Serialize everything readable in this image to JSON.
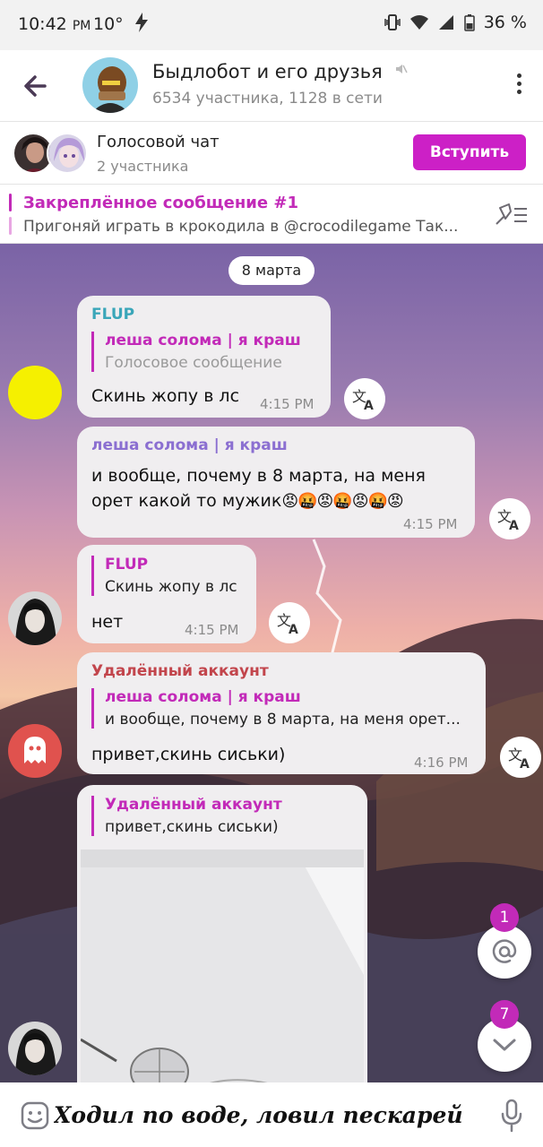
{
  "status_bar": {
    "time": "10:42",
    "ampm": "PM",
    "temp": "10°",
    "battery": "36 %"
  },
  "header": {
    "title": "Быдлобот и его друзья",
    "subtitle": "6534 участника, 1128 в сети"
  },
  "voice_chat": {
    "title": "Голосовой чат",
    "subtitle": "2 участника",
    "join_label": "Вступить"
  },
  "pinned": {
    "title": "Закреплённое сообщение #1",
    "text": "Пригоняй играть в крокодила в @crocodilegame Так..."
  },
  "chat": {
    "date": "8 марта",
    "messages": [
      {
        "sender": "FLUP",
        "reply_name": "леша солома | я краш",
        "reply_text": "Голосовое сообщение",
        "text": "Скинь жопу в лс",
        "time": "4:15 PM"
      },
      {
        "sender": "леша солома | я краш",
        "text_line1": "и вообще, почему в 8 марта, на меня",
        "text_line2": "орет какой то мужик",
        "emoji": "😡🤬😡🤬😡🤬😡",
        "time": "4:15 PM"
      },
      {
        "reply_name": "FLUP",
        "reply_text": "Скинь жопу в лс",
        "text": "нет",
        "time": "4:15 PM"
      },
      {
        "sender": "Удалённый аккаунт",
        "reply_name": "леша солома | я краш",
        "reply_text": "и вообще, почему в 8 марта, на меня орет...",
        "text": "привет,скинь сиськи)",
        "time": "4:16 PM"
      },
      {
        "reply_name": "Удалённый аккаунт",
        "reply_text": "привет,скинь сиськи)"
      }
    ],
    "mentions_count": "1",
    "unread_count": "7"
  },
  "input": {
    "value": "Ходил по воде, ловил пескарей"
  },
  "colors": {
    "accent": "#c22ab8",
    "flup": "#3aa6b9",
    "lesha": "#8b6fd1",
    "deleted": "#c2454c"
  }
}
